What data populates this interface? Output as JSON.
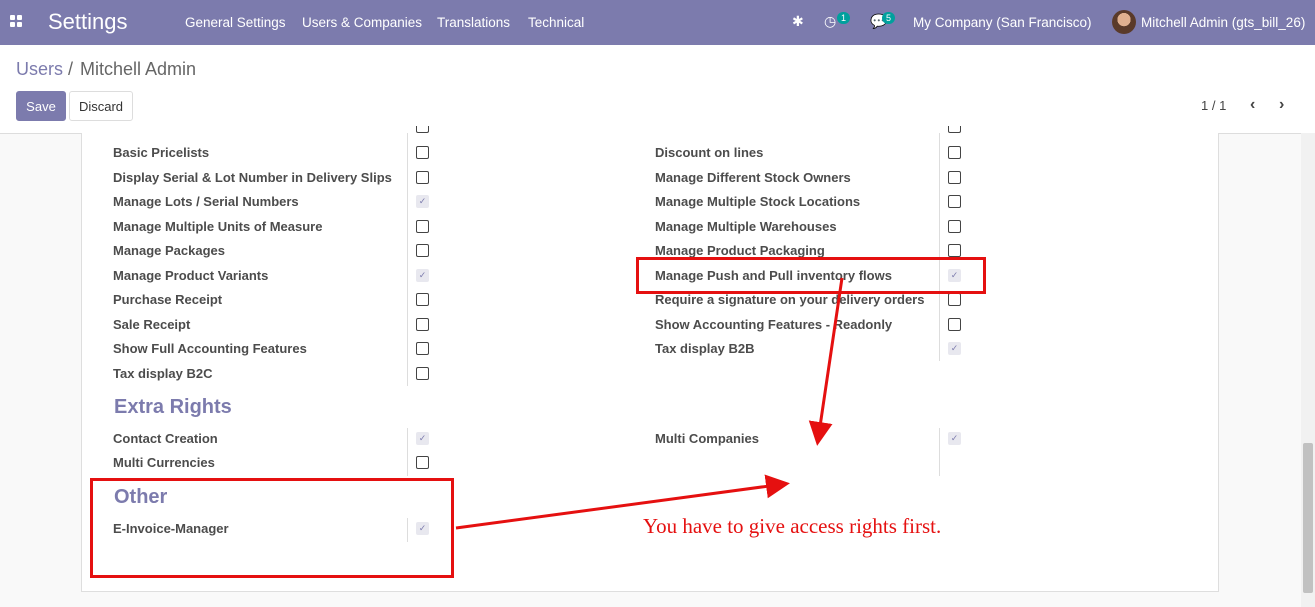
{
  "navbar": {
    "app_title": "Settings",
    "menu": [
      "General Settings",
      "Users & Companies",
      "Translations",
      "Technical"
    ],
    "activity_badge": "1",
    "messages_badge": "5",
    "company": "My Company (San Francisco)",
    "user": "Mitchell Admin (gts_bill_26)"
  },
  "breadcrumb": {
    "parent": "Users",
    "separator": "/",
    "current": "Mitchell Admin"
  },
  "buttons": {
    "save": "Save",
    "discard": "Discard"
  },
  "pager": {
    "value": "1 / 1"
  },
  "technical_rights": {
    "left": [
      {
        "label": "Basic Pricelists",
        "checked": false
      },
      {
        "label": "Display Serial & Lot Number in Delivery Slips",
        "checked": false
      },
      {
        "label": "Manage Lots / Serial Numbers",
        "checked": true
      },
      {
        "label": "Manage Multiple Units of Measure",
        "checked": false
      },
      {
        "label": "Manage Packages",
        "checked": false
      },
      {
        "label": "Manage Product Variants",
        "checked": true
      },
      {
        "label": "Purchase Receipt",
        "checked": false
      },
      {
        "label": "Sale Receipt",
        "checked": false
      },
      {
        "label": "Show Full Accounting Features",
        "checked": false
      },
      {
        "label": "Tax display B2C",
        "checked": false
      }
    ],
    "right": [
      {
        "label": "Discount on lines",
        "checked": false
      },
      {
        "label": "Manage Different Stock Owners",
        "checked": false
      },
      {
        "label": "Manage Multiple Stock Locations",
        "checked": false
      },
      {
        "label": "Manage Multiple Warehouses",
        "checked": false
      },
      {
        "label": "Manage Product Packaging",
        "checked": false
      },
      {
        "label": "Manage Push and Pull inventory flows",
        "checked": true
      },
      {
        "label": "Require a signature on your delivery orders",
        "checked": false
      },
      {
        "label": "Show Accounting Features - Readonly",
        "checked": false
      },
      {
        "label": "Tax display B2B",
        "checked": true
      }
    ]
  },
  "extra_rights": {
    "title": "Extra Rights",
    "left": [
      {
        "label": "Contact Creation",
        "checked": true
      },
      {
        "label": "Multi Currencies",
        "checked": false
      }
    ],
    "right": [
      {
        "label": "Multi Companies",
        "checked": true
      }
    ]
  },
  "other": {
    "title": "Other",
    "items": [
      {
        "label": "E-Invoice-Manager",
        "checked": true
      }
    ]
  },
  "annotation": {
    "text": "You have to give access rights first.",
    "color": "#e51010"
  },
  "colors": {
    "brand": "#7c7bad",
    "badge": "#00a09d"
  }
}
